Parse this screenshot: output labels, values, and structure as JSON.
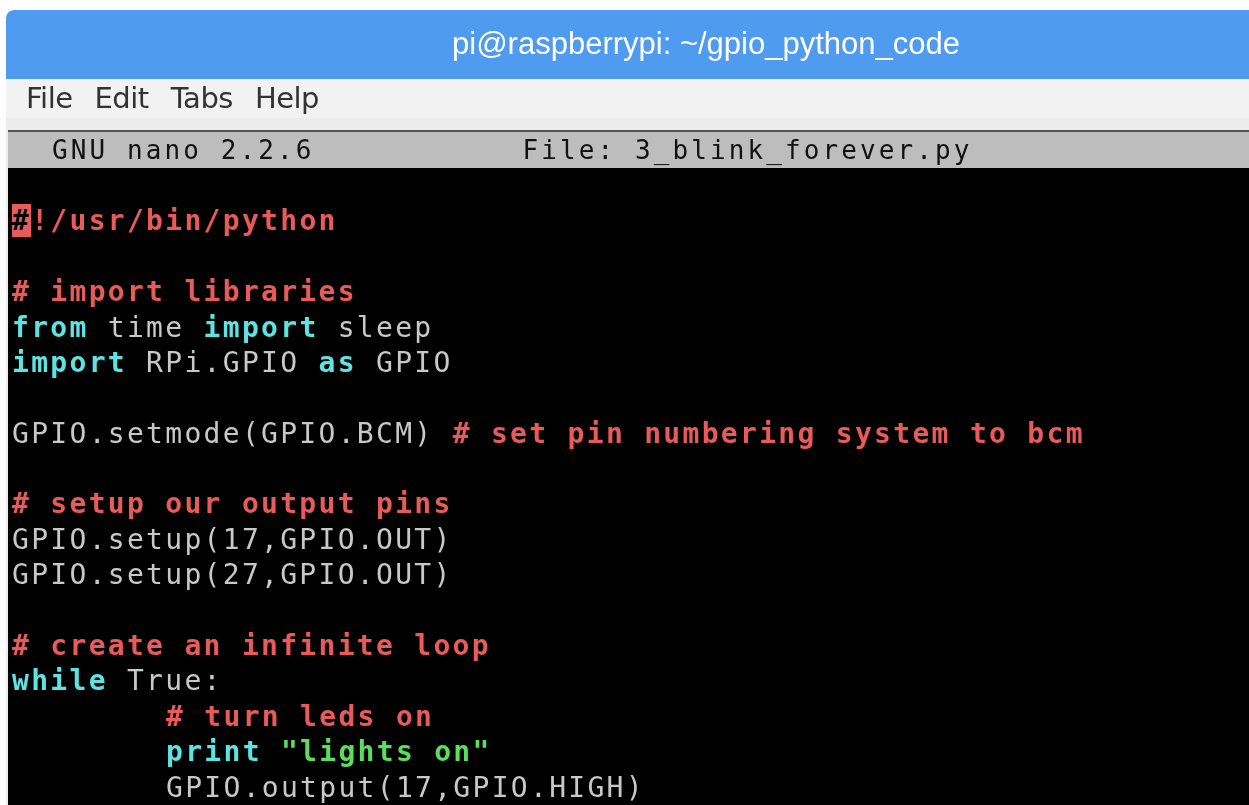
{
  "window": {
    "title": "pi@raspberrypi: ~/gpio_python_code"
  },
  "menu": [
    "File",
    "Edit",
    "Tabs",
    "Help"
  ],
  "nano_header": {
    "version": "GNU nano 2.2.6",
    "file": "File: 3_blink_forever.py"
  },
  "lines": [
    {
      "kind": "code",
      "indented": false,
      "segments": [
        {
          "kind": "cursor",
          "text": "#"
        },
        {
          "kind": "comment",
          "text": "!/usr/bin/python"
        }
      ]
    },
    {
      "kind": "blank"
    },
    {
      "kind": "code",
      "indented": false,
      "segments": [
        {
          "kind": "comment",
          "text": "# import libraries"
        }
      ]
    },
    {
      "kind": "code",
      "indented": false,
      "segments": [
        {
          "kind": "keyword",
          "text": "from"
        },
        {
          "kind": "plain",
          "text": " time "
        },
        {
          "kind": "keyword",
          "text": "import"
        },
        {
          "kind": "plain",
          "text": " sleep"
        }
      ]
    },
    {
      "kind": "code",
      "indented": false,
      "segments": [
        {
          "kind": "keyword",
          "text": "import"
        },
        {
          "kind": "plain",
          "text": " RPi.GPIO "
        },
        {
          "kind": "keyword",
          "text": "as"
        },
        {
          "kind": "plain",
          "text": " GPIO"
        }
      ]
    },
    {
      "kind": "blank"
    },
    {
      "kind": "code",
      "indented": false,
      "segments": [
        {
          "kind": "plain",
          "text": "GPIO.setmode(GPIO.BCM) "
        },
        {
          "kind": "comment",
          "text": "# set pin numbering system to bcm"
        }
      ]
    },
    {
      "kind": "blank"
    },
    {
      "kind": "code",
      "indented": false,
      "segments": [
        {
          "kind": "comment",
          "text": "# setup our output pins"
        }
      ]
    },
    {
      "kind": "code",
      "indented": false,
      "segments": [
        {
          "kind": "plain",
          "text": "GPIO.setup(17,GPIO.OUT)"
        }
      ]
    },
    {
      "kind": "code",
      "indented": false,
      "segments": [
        {
          "kind": "plain",
          "text": "GPIO.setup(27,GPIO.OUT)"
        }
      ]
    },
    {
      "kind": "blank"
    },
    {
      "kind": "code",
      "indented": false,
      "segments": [
        {
          "kind": "comment",
          "text": "# create an infinite loop"
        }
      ]
    },
    {
      "kind": "code",
      "indented": false,
      "segments": [
        {
          "kind": "keyword",
          "text": "while"
        },
        {
          "kind": "plain",
          "text": " True:"
        }
      ]
    },
    {
      "kind": "code",
      "indented": true,
      "segments": [
        {
          "kind": "comment",
          "text": "# turn leds on"
        }
      ]
    },
    {
      "kind": "code",
      "indented": true,
      "segments": [
        {
          "kind": "keyword",
          "text": "print"
        },
        {
          "kind": "string",
          "text": " \"lights on\""
        }
      ]
    },
    {
      "kind": "code",
      "indented": true,
      "segments": [
        {
          "kind": "plain",
          "text": "GPIO.output(17,GPIO.HIGH)"
        }
      ]
    }
  ]
}
